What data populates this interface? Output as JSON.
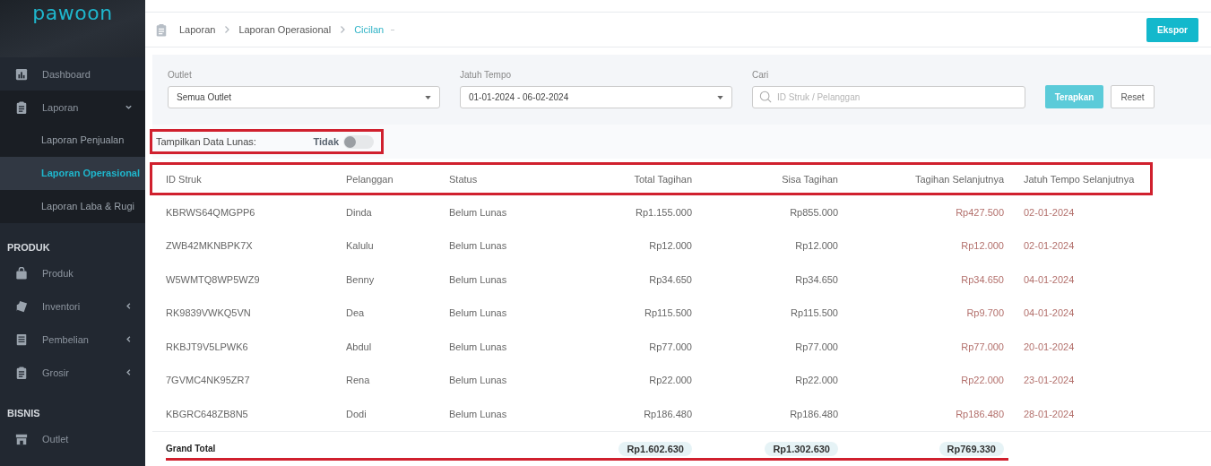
{
  "sidebar": {
    "logo": "pawoon",
    "items": [
      {
        "kind": "item",
        "label": "Dashboard",
        "selected": false
      },
      {
        "kind": "item",
        "label": "Laporan",
        "selected": false,
        "expanded": true,
        "children": [
          {
            "label": "Laporan Penjualan",
            "selected": false
          },
          {
            "label": "Laporan Operasional",
            "selected": true
          },
          {
            "label": "Laporan Laba & Rugi",
            "selected": false
          }
        ]
      },
      {
        "kind": "section",
        "label": "PRODUK"
      },
      {
        "kind": "item",
        "label": "Produk",
        "selected": false
      },
      {
        "kind": "item",
        "label": "Inventori",
        "selected": false,
        "expanded": false
      },
      {
        "kind": "item",
        "label": "Pembelian",
        "selected": false,
        "expanded": false
      },
      {
        "kind": "item",
        "label": "Grosir",
        "selected": false,
        "expanded": false
      },
      {
        "kind": "section",
        "label": "BISNIS"
      },
      {
        "kind": "item",
        "label": "Outlet",
        "selected": false
      }
    ]
  },
  "breadcrumb": [
    {
      "label": "Laporan",
      "current": false
    },
    {
      "label": "Laporan Operasional",
      "current": false
    },
    {
      "label": "Cicilan",
      "current": true
    }
  ],
  "export_button": "Ekspor",
  "filters": {
    "outlet": {
      "label": "Outlet",
      "value": "Semua Outlet"
    },
    "due": {
      "label": "Jatuh Tempo",
      "value": "01-01-2024 - 06-02-2024"
    },
    "search": {
      "label": "Cari",
      "placeholder": "ID Struk / Pelanggan"
    },
    "apply_button": "Terapkan",
    "reset_button": "Reset"
  },
  "toggle": {
    "label": "Tampilkan Data Lunas:",
    "state_text": "Tidak",
    "on": false,
    "highlighted": true
  },
  "table": {
    "header_highlighted": true,
    "columns": [
      "ID Struk",
      "Pelanggan",
      "Status",
      "Total Tagihan",
      "Sisa Tagihan",
      "Tagihan Selanjutnya",
      "Jatuh Tempo Selanjutnya"
    ],
    "rows": [
      [
        "KBRWS64QMGPP6",
        "Dinda",
        "Belum Lunas",
        "Rp1.155.000",
        "Rp855.000",
        "Rp427.500",
        "02-01-2024"
      ],
      [
        "ZWB42MKNBPK7X",
        "Kalulu",
        "Belum Lunas",
        "Rp12.000",
        "Rp12.000",
        "Rp12.000",
        "02-01-2024"
      ],
      [
        "W5WMTQ8WP5WZ9",
        "Benny",
        "Belum Lunas",
        "Rp34.650",
        "Rp34.650",
        "Rp34.650",
        "04-01-2024"
      ],
      [
        "RK9839VWKQ5VN",
        "Dea",
        "Belum Lunas",
        "Rp115.500",
        "Rp115.500",
        "Rp9.700",
        "04-01-2024"
      ],
      [
        "RKBJT9V5LPWK6",
        "Abdul",
        "Belum Lunas",
        "Rp77.000",
        "Rp77.000",
        "Rp77.000",
        "20-01-2024"
      ],
      [
        "7GVMC4NK95ZR7",
        "Rena",
        "Belum Lunas",
        "Rp22.000",
        "Rp22.000",
        "Rp22.000",
        "23-01-2024"
      ],
      [
        "KBGRC648ZB8N5",
        "Dodi",
        "Belum Lunas",
        "Rp186.480",
        "Rp186.480",
        "Rp186.480",
        "28-01-2024"
      ]
    ],
    "total": {
      "label": "Grand Total",
      "values": [
        "Rp1.602.630",
        "Rp1.302.630",
        "Rp769.330"
      ],
      "underlined": true
    }
  }
}
